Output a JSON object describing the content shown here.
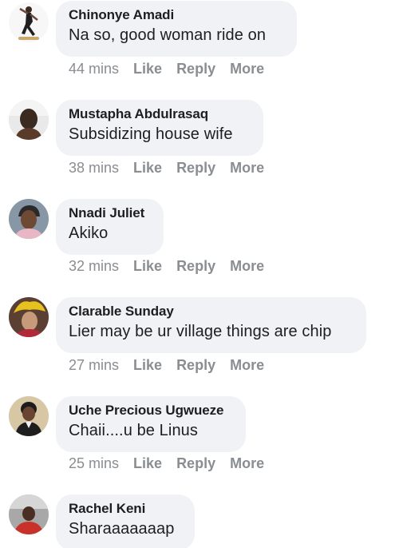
{
  "comments": [
    {
      "author": "Chinonye Amadi",
      "text": "Na so, good woman ride on",
      "time": "44 mins",
      "avatar_icon": "avatar-woman-dancing",
      "avatar_bg": "#ffffff"
    },
    {
      "author": "Mustapha Abdulrasaq",
      "text": "Subsidizing house wife",
      "time": "38 mins",
      "avatar_icon": "avatar-man",
      "avatar_bg": "#e8e8e8"
    },
    {
      "author": "Nnadi Juliet",
      "text": "Akiko",
      "time": "32 mins",
      "avatar_icon": "avatar-woman-headwrap",
      "avatar_bg": "#8a9aa8"
    },
    {
      "author": "Clarable Sunday",
      "text": "Lier may be ur village things are chip",
      "time": "27 mins",
      "avatar_icon": "avatar-woman-yellow-hat",
      "avatar_bg": "#6b4a3a"
    },
    {
      "author": "Uche Precious Ugwueze",
      "text": "Chaii....u be Linus",
      "time": "25 mins",
      "avatar_icon": "avatar-child-uniform",
      "avatar_bg": "#d9c9a8"
    },
    {
      "author": "Rachel Keni",
      "text": "Sharaaaaaaap",
      "time": "",
      "avatar_icon": "avatar-woman-red",
      "avatar_bg": "#c23a2e"
    }
  ],
  "actions": {
    "like": "Like",
    "reply": "Reply",
    "more": "More"
  },
  "colors": {
    "bubble": "#f0f2f5",
    "name_text": "#1c1e21",
    "meta_text": "#8a8d91"
  }
}
